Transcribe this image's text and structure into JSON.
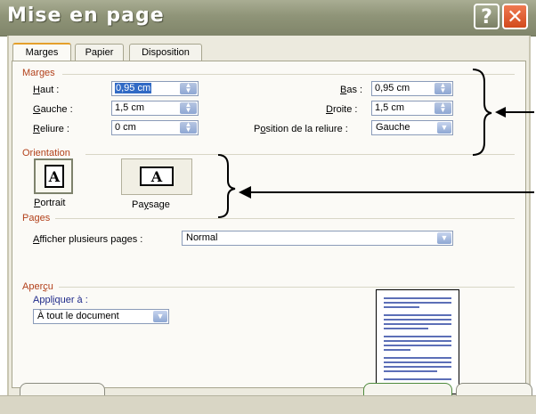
{
  "window": {
    "title": "Mise en page",
    "help_glyph": "?",
    "close_glyph": "✕"
  },
  "tabs": [
    {
      "label": "Marges"
    },
    {
      "label": "Papier"
    },
    {
      "label": "Disposition"
    }
  ],
  "marges": {
    "title": "Marges",
    "haut": {
      "label_accel": "H",
      "label_rest": "aut :",
      "value": "0,95 cm"
    },
    "gauche": {
      "label_accel": "G",
      "label_rest": "auche :",
      "value": "1,5 cm"
    },
    "reliure": {
      "label_accel": "R",
      "label_rest": "eliure :",
      "value": "0 cm"
    },
    "bas": {
      "label_accel": "B",
      "label_rest": "as :",
      "value": "0,95 cm"
    },
    "droite": {
      "label_accel": "D",
      "label_rest": "roite :",
      "value": "1,5 cm"
    },
    "position_reliure": {
      "label_pre": "P",
      "label_accel": "o",
      "label_rest": "sition de la reliure :",
      "value": "Gauche"
    }
  },
  "orientation": {
    "title": "Orientation",
    "portrait": {
      "label_accel": "P",
      "label_rest": "ortrait",
      "glyph": "A"
    },
    "paysage": {
      "label_pre": "Pa",
      "label_accel": "y",
      "label_rest": "sage",
      "glyph": "A"
    }
  },
  "pages": {
    "title": "Pages",
    "label_accel": "A",
    "label_rest": "fficher plusieurs pages :",
    "value": "Normal"
  },
  "apercu": {
    "title_pre": "Aper",
    "title_accel": "ç",
    "title_rest": "u",
    "appliquer_pre": "Appl",
    "appliquer_accel": "i",
    "appliquer_rest": "quer à :",
    "value": "À tout le document"
  },
  "colors": {
    "accent": "#e5a02b",
    "group_title": "#b2401a",
    "dialog_bg": "#eceade",
    "titlebar": "#8f9478"
  }
}
